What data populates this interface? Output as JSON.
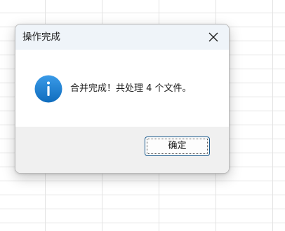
{
  "dialog": {
    "title": "操作完成",
    "message": "合并完成！共处理 4 个文件。",
    "ok_label": "确定",
    "icon": "info-icon",
    "close_icon": "close-icon"
  },
  "colors": {
    "title_bar": "#eff4f9",
    "footer": "#f0f0f0",
    "icon_blue": "#1a7fd4",
    "button_border": "#1b5a8c"
  }
}
